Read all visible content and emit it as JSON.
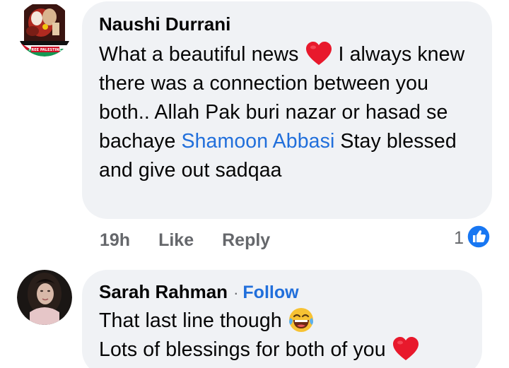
{
  "comments": [
    {
      "author": "Naushi Durrani",
      "avatar_badge": "FREE PALESTINE",
      "text_part1": "What a beautiful news ",
      "text_part2": " I always knew there was a connection between you both.. Allah Pak buri nazar or hasad se bachaye ",
      "mention": "Shamoon Abbasi",
      "text_part3": " Stay blessed and give out sadqaa",
      "time": "19h",
      "like_label": "Like",
      "reply_label": "Reply",
      "reaction_count": "1",
      "reaction_icon": "like-thumb-icon",
      "heart_color": "#e8192c"
    },
    {
      "author": "Sarah Rahman",
      "separator": "·",
      "follow_label": "Follow",
      "line1": "That last line though ",
      "line2": "Lots of blessings for both of you ",
      "emoji1": "laughing-tears-emoji",
      "emoji2": "red-heart-emoji"
    }
  ],
  "colors": {
    "bubble_bg": "#f0f2f5",
    "link_blue": "#216fdb",
    "meta_gray": "#65676b",
    "like_blue": "#1877f2"
  }
}
